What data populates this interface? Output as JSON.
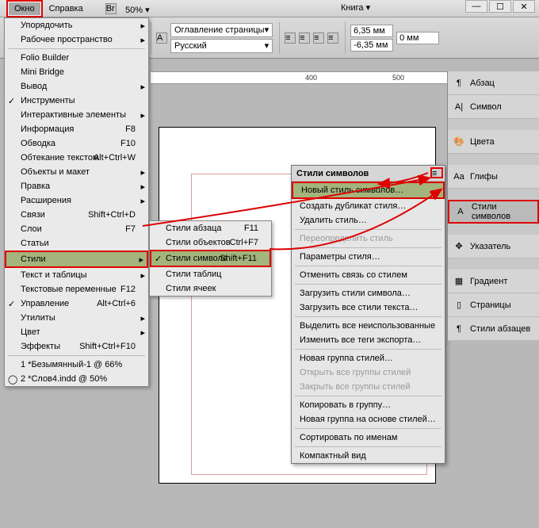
{
  "menubar": {
    "window_label": "Окно",
    "help_label": "Справка",
    "br_label": "Br",
    "zoom_value": "50%",
    "book_label": "Книга"
  },
  "toolbar": {
    "pagecontents_label": "Оглавление страницы",
    "language_label": "Русский",
    "measure_a": "6,35 мм",
    "measure_b": "-6,35 мм",
    "measure_c": "0 мм"
  },
  "ruler": {
    "marks": [
      "400",
      "500"
    ]
  },
  "window_menu": {
    "items": [
      {
        "label": "Упорядочить",
        "arrow": true
      },
      {
        "label": "Рабочее пространство",
        "arrow": true
      },
      {
        "sep": true
      },
      {
        "label": "Folio Builder"
      },
      {
        "label": "Mini Bridge"
      },
      {
        "label": "Вывод",
        "arrow": true
      },
      {
        "label": "Инструменты",
        "check": true
      },
      {
        "label": "Интерактивные элементы",
        "arrow": true
      },
      {
        "label": "Информация",
        "shortcut": "F8"
      },
      {
        "label": "Обводка",
        "shortcut": "F10"
      },
      {
        "label": "Обтекание текстом",
        "shortcut": "Alt+Ctrl+W"
      },
      {
        "label": "Объекты и макет",
        "arrow": true
      },
      {
        "label": "Правка",
        "arrow": true
      },
      {
        "label": "Расширения",
        "arrow": true
      },
      {
        "label": "Связи",
        "shortcut": "Shift+Ctrl+D"
      },
      {
        "label": "Слои",
        "shortcut": "F7"
      },
      {
        "label": "Статьи"
      },
      {
        "label": "Стили",
        "highlight": true,
        "arrow": true
      },
      {
        "label": "Текст и таблицы",
        "arrow": true
      },
      {
        "label": "Текстовые переменные",
        "shortcut": "F12"
      },
      {
        "label": "Управление",
        "shortcut": "Alt+Ctrl+6",
        "check": true
      },
      {
        "label": "Утилиты",
        "arrow": true
      },
      {
        "label": "Цвет",
        "arrow": true
      },
      {
        "label": "Эффекты",
        "shortcut": "Shift+Ctrl+F10"
      },
      {
        "sep": true
      },
      {
        "label": "1 *Безымянный-1 @ 66%"
      },
      {
        "label": "2 *Слов4.indd @ 50%",
        "check": "◯"
      }
    ]
  },
  "styles_submenu": {
    "items": [
      {
        "label": "Стили абзаца",
        "shortcut": "F11"
      },
      {
        "label": "Стили объектов",
        "shortcut": "Ctrl+F7"
      },
      {
        "label": "Стили символа",
        "shortcut": "Shift+F11",
        "highlight": true,
        "check": true
      },
      {
        "label": "Стили таблиц"
      },
      {
        "label": "Стили ячеек"
      }
    ]
  },
  "charstyles_panel": {
    "title": "Стили символов",
    "items": [
      {
        "label": "Новый стиль символов…",
        "highlight": true
      },
      {
        "label": "Создать дубликат стиля…"
      },
      {
        "label": "Удалить стиль…"
      },
      {
        "sep": true
      },
      {
        "label": "Переопределить стиль",
        "disabled": true
      },
      {
        "sep": true
      },
      {
        "label": "Параметры стиля…"
      },
      {
        "sep": true
      },
      {
        "label": "Отменить связь со стилем"
      },
      {
        "sep": true
      },
      {
        "label": "Загрузить стили символа…"
      },
      {
        "label": "Загрузить все стили текста…"
      },
      {
        "sep": true
      },
      {
        "label": "Выделить все неиспользованные"
      },
      {
        "label": "Изменить все теги экспорта…"
      },
      {
        "sep": true
      },
      {
        "label": "Новая группа стилей…"
      },
      {
        "label": "Открыть все группы стилей",
        "disabled": true
      },
      {
        "label": "Закрыть все группы стилей",
        "disabled": true
      },
      {
        "sep": true
      },
      {
        "label": "Копировать в группу…"
      },
      {
        "label": "Новая группа на основе стилей…"
      },
      {
        "sep": true
      },
      {
        "label": "Сортировать по именам"
      },
      {
        "sep": true
      },
      {
        "label": "Компактный вид"
      }
    ]
  },
  "right_dock": {
    "items": [
      {
        "label": "Абзац",
        "icon": "¶"
      },
      {
        "label": "Символ",
        "icon": "A|"
      },
      {
        "gap": true
      },
      {
        "label": "Цвета",
        "icon": "🎨"
      },
      {
        "gap": true
      },
      {
        "label": "Глифы",
        "icon": "Aa"
      },
      {
        "gap": true
      },
      {
        "label": "Стили символов",
        "icon": "A",
        "active": true
      },
      {
        "gap": true
      },
      {
        "label": "Указатель",
        "icon": "✥"
      },
      {
        "gap": true
      },
      {
        "label": "Градиент",
        "icon": "▦"
      },
      {
        "label": "Страницы",
        "icon": "▯"
      },
      {
        "label": "Стили абзацев",
        "icon": "¶"
      }
    ]
  }
}
